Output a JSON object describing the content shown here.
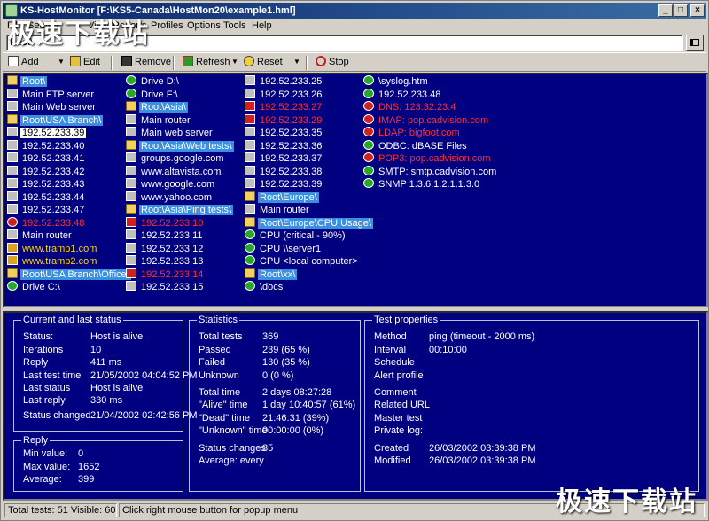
{
  "window": {
    "title": "KS-HostMonitor  [F:\\KS5-Canada\\HostMon20\\example1.hml]",
    "min_label": "_",
    "max_label": "□",
    "close_label": "×"
  },
  "menu": [
    {
      "label": "File"
    },
    {
      "label": "Search"
    },
    {
      "label": "View"
    },
    {
      "label": "Reports"
    },
    {
      "label": "Profiles"
    },
    {
      "label": "Options"
    },
    {
      "label": "Tools"
    },
    {
      "label": "Help"
    }
  ],
  "path": {
    "value": "Root\\"
  },
  "toolbar": {
    "add": "Add",
    "edit": "Edit",
    "remove": "Remove",
    "refresh": "Refresh",
    "reset": "Reset",
    "stop": "Stop",
    "dropdown_glyph": "▼"
  },
  "hosts": {
    "col1": [
      {
        "label": "Root\\",
        "kind": "folder",
        "icon": "folder-icon"
      },
      {
        "label": "Main FTP server",
        "kind": "ok",
        "icon": "computer-icon"
      },
      {
        "label": "Main Web server",
        "kind": "ok",
        "icon": "computer-icon"
      },
      {
        "label": "Root\\USA Branch\\",
        "kind": "folder",
        "icon": "folder-icon"
      },
      {
        "label": "192.52.233.39",
        "kind": "sel",
        "icon": "computer-icon"
      },
      {
        "label": "192.52.233.40",
        "kind": "ok",
        "icon": "computer-icon"
      },
      {
        "label": "192.52.233.41",
        "kind": "ok",
        "icon": "computer-icon"
      },
      {
        "label": "192.52.233.42",
        "kind": "ok",
        "icon": "computer-icon"
      },
      {
        "label": "192.52.233.43",
        "kind": "ok",
        "icon": "computer-icon"
      },
      {
        "label": "192.52.233.44",
        "kind": "ok",
        "icon": "computer-icon"
      },
      {
        "label": "192.52.233.47",
        "kind": "ok",
        "icon": "computer-icon"
      },
      {
        "label": "192.52.233.48",
        "kind": "dead",
        "icon": "stop-icon"
      },
      {
        "label": "Main router",
        "kind": "ok",
        "icon": "computer-icon"
      },
      {
        "label": "www.tramp1.com",
        "kind": "warn",
        "icon": "warning-icon"
      },
      {
        "label": "www.tramp2.com",
        "kind": "warn",
        "icon": "warning-icon"
      },
      {
        "label": "Root\\USA Branch\\Office\\",
        "kind": "folder",
        "icon": "folder-icon"
      },
      {
        "label": "Drive C:\\",
        "kind": "ok",
        "icon": "ok-icon"
      }
    ],
    "col2": [
      {
        "label": "Drive D:\\",
        "kind": "ok",
        "icon": "ok-icon"
      },
      {
        "label": "Drive F:\\",
        "kind": "ok",
        "icon": "ok-icon"
      },
      {
        "label": "Root\\Asia\\",
        "kind": "folder",
        "icon": "folder-icon"
      },
      {
        "label": "Main router",
        "kind": "ok",
        "icon": "computer-icon"
      },
      {
        "label": "Main web server",
        "kind": "ok",
        "icon": "computer-icon"
      },
      {
        "label": "Root\\Asia\\Web tests\\",
        "kind": "folder",
        "icon": "folder-icon"
      },
      {
        "label": "groups.google.com",
        "kind": "ok",
        "icon": "computer-icon"
      },
      {
        "label": "www.altavista.com",
        "kind": "ok",
        "icon": "computer-icon"
      },
      {
        "label": "www.google.com",
        "kind": "ok",
        "icon": "computer-icon"
      },
      {
        "label": "www.yahoo.com",
        "kind": "ok",
        "icon": "computer-icon"
      },
      {
        "label": "Root\\Asia\\Ping tests\\",
        "kind": "folder",
        "icon": "folder-icon"
      },
      {
        "label": "192.52.233.10",
        "kind": "dead",
        "icon": "dead-computer-icon"
      },
      {
        "label": "192.52.233.11",
        "kind": "ok",
        "icon": "computer-icon"
      },
      {
        "label": "192.52.233.12",
        "kind": "ok",
        "icon": "computer-icon"
      },
      {
        "label": "192.52.233.13",
        "kind": "ok",
        "icon": "computer-icon"
      },
      {
        "label": "192.52.233.14",
        "kind": "dead",
        "icon": "dead-computer-icon"
      },
      {
        "label": "192.52.233.15",
        "kind": "ok",
        "icon": "computer-icon"
      }
    ],
    "col3": [
      {
        "label": "192.52.233.25",
        "kind": "ok",
        "icon": "computer-icon"
      },
      {
        "label": "192.52.233.26",
        "kind": "ok",
        "icon": "computer-icon"
      },
      {
        "label": "192.52.233.27",
        "kind": "dead",
        "icon": "dead-computer-icon"
      },
      {
        "label": "192.52.233.29",
        "kind": "dead",
        "icon": "dead-computer-icon"
      },
      {
        "label": "192.52.233.35",
        "kind": "ok",
        "icon": "computer-icon"
      },
      {
        "label": "192.52.233.36",
        "kind": "ok",
        "icon": "computer-icon"
      },
      {
        "label": "192.52.233.37",
        "kind": "ok",
        "icon": "computer-icon"
      },
      {
        "label": "192.52.233.38",
        "kind": "ok",
        "icon": "computer-icon"
      },
      {
        "label": "192.52.233.39",
        "kind": "ok",
        "icon": "computer-icon"
      },
      {
        "label": "Root\\Europe\\",
        "kind": "folder",
        "icon": "folder-icon"
      },
      {
        "label": "Main router",
        "kind": "ok",
        "icon": "computer-icon"
      },
      {
        "label": "Root\\Europe\\CPU Usage\\",
        "kind": "folder",
        "icon": "folder-icon"
      },
      {
        "label": "CPU (critical - 90%)",
        "kind": "ok",
        "icon": "ok-icon"
      },
      {
        "label": "CPU \\\\server1",
        "kind": "ok",
        "icon": "ok-icon"
      },
      {
        "label": "CPU <local computer>",
        "kind": "ok",
        "icon": "ok-icon"
      },
      {
        "label": "Root\\xx\\",
        "kind": "folder",
        "icon": "folder-icon"
      },
      {
        "label": "\\docs",
        "kind": "ok",
        "icon": "ok-icon"
      }
    ],
    "col4": [
      {
        "label": "\\syslog.htm",
        "kind": "ok",
        "icon": "ok-icon"
      },
      {
        "label": "192.52.233.48",
        "kind": "ok",
        "icon": "ok-icon"
      },
      {
        "label": "DNS:  123.32.23.4",
        "kind": "dead",
        "icon": "stop-icon"
      },
      {
        "label": "IMAP: pop.cadvision.com",
        "kind": "dead",
        "icon": "stop-icon"
      },
      {
        "label": "LDAP: bigfoot.com",
        "kind": "dead",
        "icon": "stop-icon"
      },
      {
        "label": "ODBC: dBASE Files",
        "kind": "ok",
        "icon": "ok-icon"
      },
      {
        "label": "POP3: pop.cadvision.com",
        "kind": "dead",
        "icon": "stop-icon"
      },
      {
        "label": "SMTP: smtp.cadvision.com",
        "kind": "ok",
        "icon": "ok-icon"
      },
      {
        "label": "SNMP 1.3.6.1.2.1.1.3.0",
        "kind": "ok",
        "icon": "ok-icon"
      }
    ]
  },
  "status_group": {
    "title": "Current and last status",
    "rows": [
      {
        "label": "Status:",
        "value": "Host is alive"
      },
      {
        "label": "Iterations",
        "value": "10"
      },
      {
        "label": "Reply",
        "value": "411 ms"
      },
      {
        "label": "Last test time",
        "value": "21/05/2002 04:04:52 PM"
      },
      {
        "label": "Last status",
        "value": "Host is alive"
      },
      {
        "label": "Last reply",
        "value": "330 ms"
      },
      {
        "label": "Status changed",
        "value": "21/04/2002 02:42:56 PM"
      }
    ]
  },
  "reply_group": {
    "title": "Reply",
    "rows": [
      {
        "label": "Min value:",
        "value": "0"
      },
      {
        "label": "Max value:",
        "value": "1652"
      },
      {
        "label": "Average:",
        "value": "399"
      }
    ]
  },
  "stats_group": {
    "title": "Statistics",
    "rows": [
      {
        "label": "Total tests",
        "value": "369"
      },
      {
        "label": "Passed",
        "value": "239 (65 %)"
      },
      {
        "label": "Failed",
        "value": "130 (35 %)"
      },
      {
        "label": "Unknown",
        "value": "0 (0 %)"
      },
      {
        "label": "Total time",
        "value": "2 days 08:27:28"
      },
      {
        "label": "\"Alive\" time",
        "value": "1 day 10:40:57 (61%)"
      },
      {
        "label": "\"Dead\" time",
        "value": "21:46:31 (39%)"
      },
      {
        "label": "\"Unknown\" time",
        "value": "00:00:00 (0%)"
      },
      {
        "label": "Status changes",
        "value": "35"
      },
      {
        "label": "Average: every",
        "value": ""
      }
    ]
  },
  "props_group": {
    "title": "Test properties",
    "rows": [
      {
        "label": "Method",
        "value": "ping (timeout - 2000 ms)"
      },
      {
        "label": "Interval",
        "value": "00:10:00"
      },
      {
        "label": "Schedule",
        "value": ""
      },
      {
        "label": "Alert profile",
        "value": ""
      },
      {
        "label": "Comment",
        "value": ""
      },
      {
        "label": "Related URL",
        "value": ""
      },
      {
        "label": "Master test",
        "value": ""
      },
      {
        "label": "Private log:",
        "value": ""
      },
      {
        "label": "Created",
        "value": "26/03/2002 03:39:38 PM"
      },
      {
        "label": "Modified",
        "value": "26/03/2002 03:39:38 PM"
      }
    ]
  },
  "statusbar": {
    "counts": "Total tests: 51   Visible: 60",
    "hint": "Click right mouse button for popup menu"
  },
  "watermark": {
    "top": "极速下载站",
    "bottom": "极速下载站"
  }
}
